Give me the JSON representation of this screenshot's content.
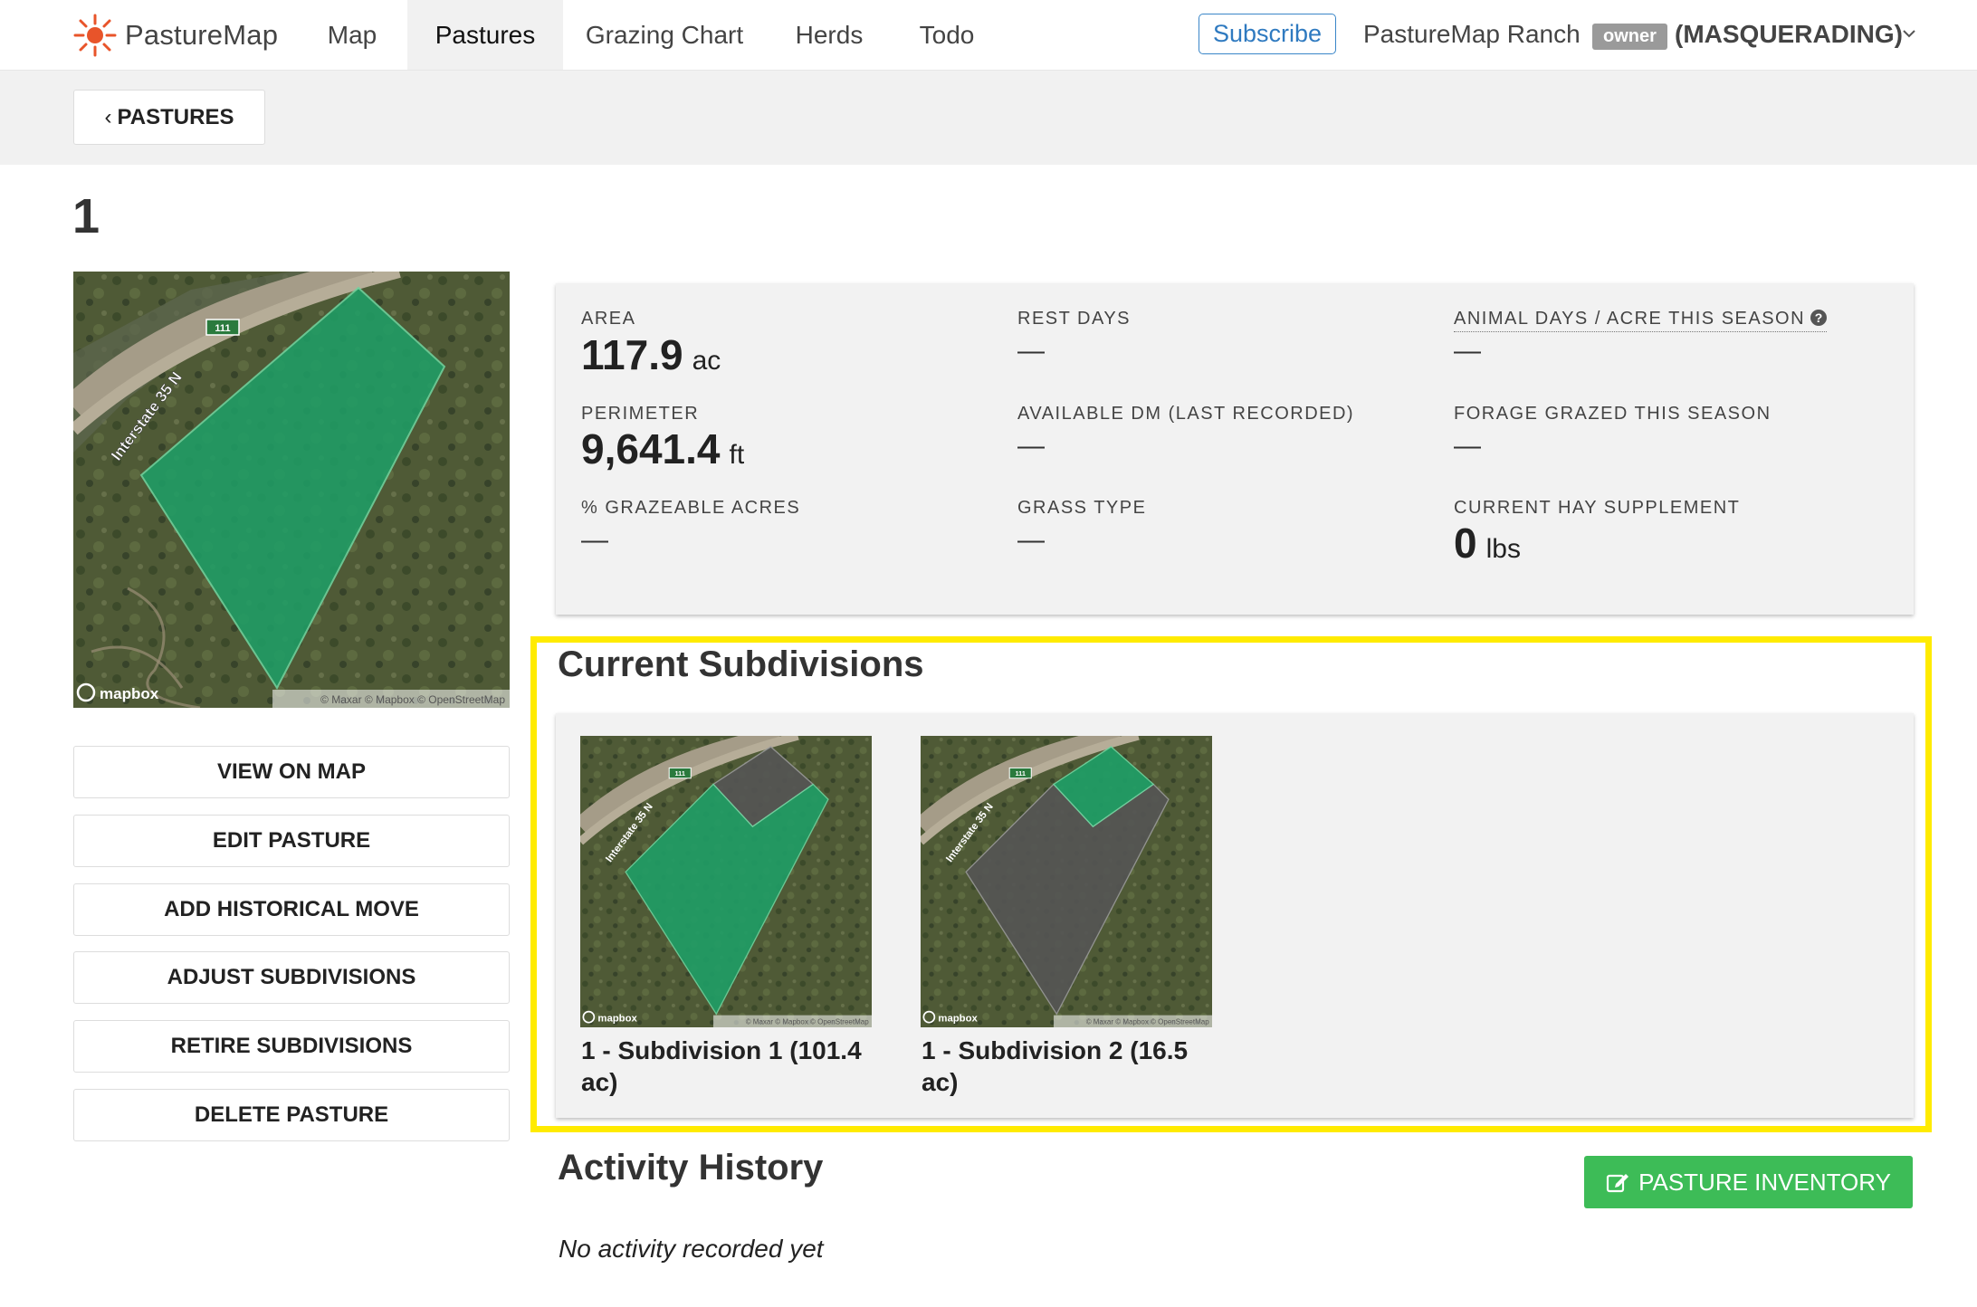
{
  "nav": {
    "brand": "PastureMap",
    "items": [
      {
        "label": "Map",
        "active": false
      },
      {
        "label": "Pastures",
        "active": true
      },
      {
        "label": "Grazing Chart",
        "active": false
      },
      {
        "label": "Herds",
        "active": false
      },
      {
        "label": "Todo",
        "active": false
      }
    ],
    "subscribe_label": "Subscribe",
    "ranch_name": "PastureMap Ranch",
    "role_badge": "owner",
    "masquerade_label": "(MASQUERADING)",
    "accent_color": "#2f7ac0"
  },
  "breadcrumb": {
    "back_label": "PASTURES"
  },
  "pasture": {
    "title": "1"
  },
  "map": {
    "interstate_label": "Interstate 35 N",
    "route_shield": "111",
    "mapbox_label": "mapbox",
    "attribution": "© Maxar © Mapbox © OpenStreetMap",
    "pasture_color": "#1f9e66"
  },
  "actions": [
    {
      "label": "VIEW ON MAP"
    },
    {
      "label": "EDIT PASTURE"
    },
    {
      "label": "ADD HISTORICAL MOVE"
    },
    {
      "label": "ADJUST SUBDIVISIONS"
    },
    {
      "label": "RETIRE SUBDIVISIONS"
    },
    {
      "label": "DELETE PASTURE"
    }
  ],
  "stats": {
    "area": {
      "label": "AREA",
      "value": "117.9",
      "unit": "ac"
    },
    "perimeter": {
      "label": "PERIMETER",
      "value": "9,641.4",
      "unit": "ft"
    },
    "grazeable": {
      "label": "% GRAZEABLE ACRES",
      "value": "—"
    },
    "rest_days": {
      "label": "REST DAYS",
      "value": "—"
    },
    "available_dm": {
      "label": "AVAILABLE DM (LAST RECORDED)",
      "value": "—"
    },
    "grass_type": {
      "label": "GRASS TYPE",
      "value": "—"
    },
    "animal_days": {
      "label": "ANIMAL DAYS / ACRE THIS SEASON",
      "value": "—"
    },
    "forage_grazed": {
      "label": "FORAGE GRAZED THIS SEASON",
      "value": "—"
    },
    "hay_supplement": {
      "label": "CURRENT HAY SUPPLEMENT",
      "value": "0",
      "unit": "lbs"
    }
  },
  "subdivisions": {
    "title": "Current Subdivisions",
    "items": [
      {
        "label": "1 - Subdivision 1 (101.4 ac)"
      },
      {
        "label": "1 - Subdivision 2 (16.5 ac)"
      }
    ],
    "highlight_color": "#ffeb00"
  },
  "activity": {
    "title": "Activity History",
    "inventory_label": "PASTURE INVENTORY",
    "empty_text": "No activity recorded yet",
    "button_color": "#3dbc57"
  }
}
